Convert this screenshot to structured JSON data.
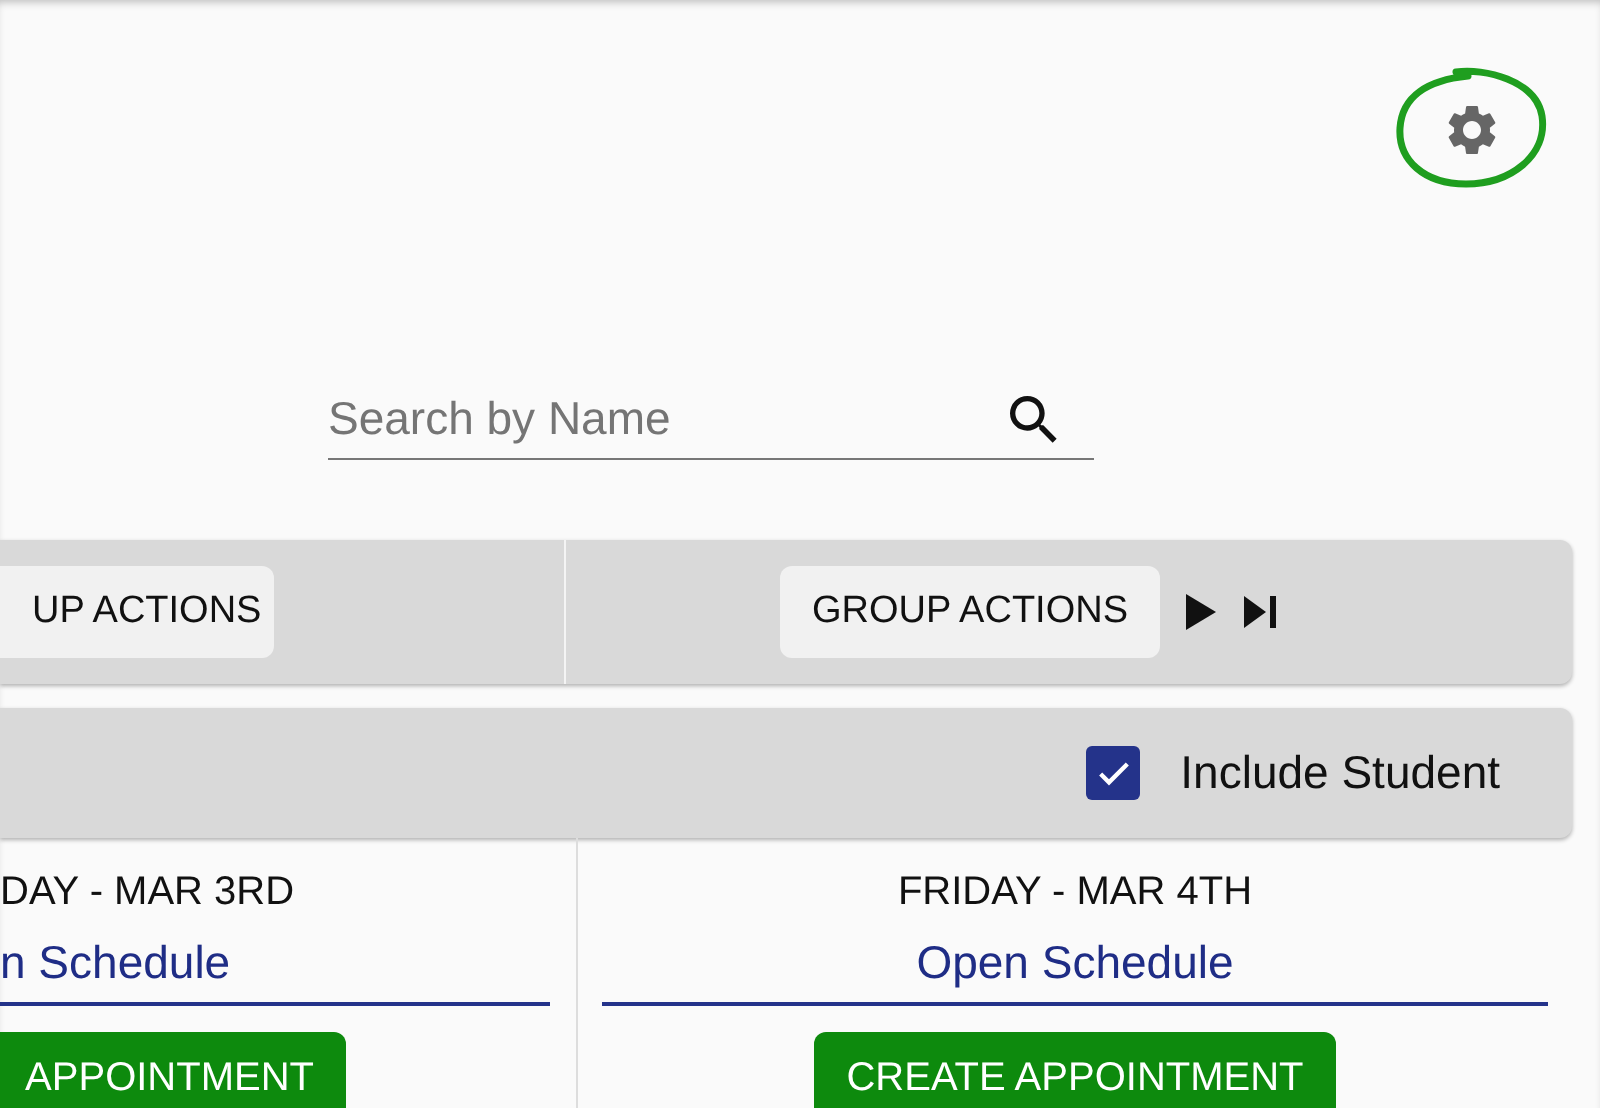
{
  "settings": {
    "highlighted": true
  },
  "search": {
    "placeholder": "Search by Name"
  },
  "toolbar": {
    "groups": [
      {
        "button": "UP ACTIONS",
        "nav": false
      },
      {
        "button": "GROUP ACTIONS",
        "nav": true
      }
    ]
  },
  "options": {
    "include_student": {
      "label": "Include Student",
      "checked": true
    }
  },
  "days": [
    {
      "date": "DAY - MAR 3RD",
      "link": "n Schedule",
      "button": "APPOINTMENT"
    },
    {
      "date": "FRIDAY - MAR 4TH",
      "link": "Open Schedule",
      "button": "CREATE APPOINTMENT"
    }
  ]
}
